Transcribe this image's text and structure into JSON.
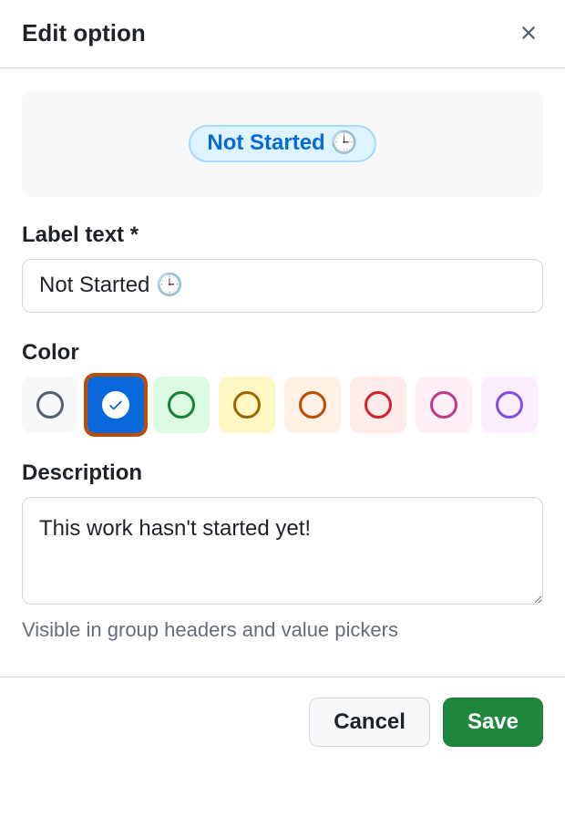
{
  "header": {
    "title": "Edit option"
  },
  "preview": {
    "label": "Not Started",
    "emoji": "🕒"
  },
  "labelText": {
    "label": "Label text *",
    "value": "Not Started 🕒"
  },
  "color": {
    "label": "Color",
    "selected": "blue",
    "options": [
      "gray",
      "blue",
      "green",
      "yellow",
      "orange",
      "red",
      "pink",
      "purple"
    ]
  },
  "description": {
    "label": "Description",
    "value": "This work hasn't started yet!",
    "hint": "Visible in group headers and value pickers"
  },
  "footer": {
    "cancel": "Cancel",
    "save": "Save"
  }
}
